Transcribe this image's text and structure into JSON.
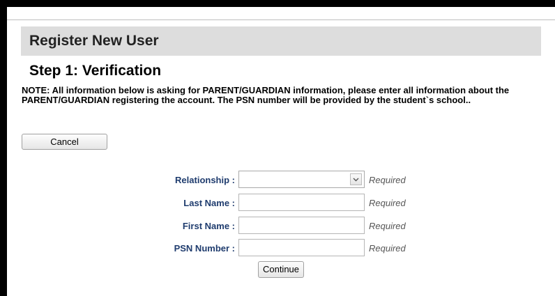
{
  "header": {
    "title": "Register New User"
  },
  "step": {
    "title": "Step 1: Verification"
  },
  "note": {
    "text": "NOTE: All information below is asking for PARENT/GUARDIAN information, please enter all information about the PARENT/GUARDIAN registering the account. The PSN number will be provided by the student`s school.."
  },
  "actions": {
    "cancel_label": "Cancel",
    "continue_label": "Continue"
  },
  "form": {
    "relationship": {
      "label": "Relationship :",
      "selected": "",
      "required": "Required"
    },
    "last_name": {
      "label": "Last Name :",
      "value": "",
      "required": "Required"
    },
    "first_name": {
      "label": "First Name :",
      "value": "",
      "required": "Required"
    },
    "psn_number": {
      "label": "PSN Number :",
      "value": "",
      "required": "Required"
    }
  },
  "icons": {
    "dropdown": "chevron-down-icon"
  },
  "colors": {
    "header_band": "#dddddd",
    "label_text": "#1f3c6e",
    "required_text": "#555555"
  }
}
